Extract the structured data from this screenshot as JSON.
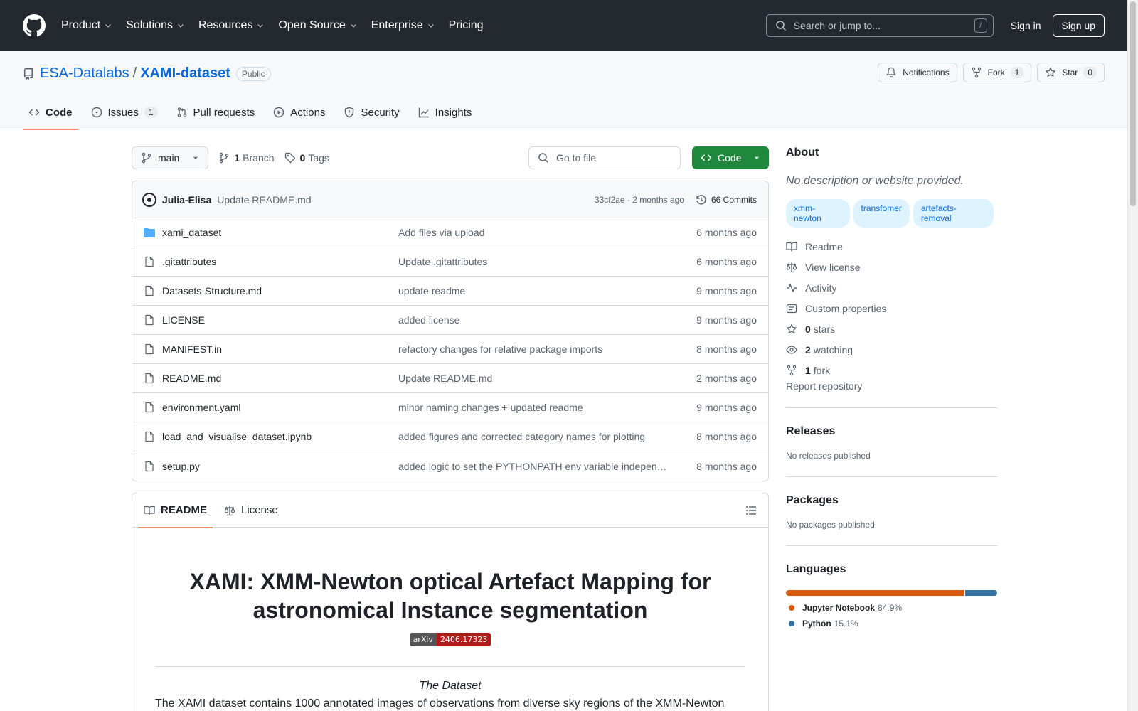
{
  "header": {
    "nav": [
      {
        "label": "Product",
        "dropdown": true
      },
      {
        "label": "Solutions",
        "dropdown": true
      },
      {
        "label": "Resources",
        "dropdown": true
      },
      {
        "label": "Open Source",
        "dropdown": true
      },
      {
        "label": "Enterprise",
        "dropdown": true
      },
      {
        "label": "Pricing",
        "dropdown": false
      }
    ],
    "search_placeholder": "Search or jump to...",
    "search_shortcut": "/",
    "sign_in": "Sign in",
    "sign_up": "Sign up"
  },
  "repo": {
    "owner": "ESA-Datalabs",
    "separator": "/",
    "name": "XAMI-dataset",
    "visibility": "Public",
    "actions": {
      "notifications": "Notifications",
      "fork_label": "Fork",
      "fork_count": "1",
      "star_label": "Star",
      "star_count": "0"
    },
    "tabs": [
      {
        "label": "Code",
        "icon": "code-icon",
        "active": true
      },
      {
        "label": "Issues",
        "icon": "issue-opened-icon",
        "counter": "1"
      },
      {
        "label": "Pull requests",
        "icon": "git-pull-request-icon"
      },
      {
        "label": "Actions",
        "icon": "play-icon"
      },
      {
        "label": "Security",
        "icon": "shield-icon"
      },
      {
        "label": "Insights",
        "icon": "graph-icon"
      }
    ]
  },
  "toolbar": {
    "branch": "main",
    "branch_count": "1",
    "branch_label": "Branch",
    "tag_count": "0",
    "tag_label": "Tags",
    "goto_placeholder": "Go to file",
    "code_button": "Code"
  },
  "latest_commit": {
    "author": "Julia-Elisa",
    "message": "Update README.md",
    "meta": "33cf2ae · 2 months ago",
    "commits": "66 Commits"
  },
  "files": [
    {
      "type": "dir",
      "name": "xami_dataset",
      "commit": "Add files via upload",
      "age": "6 months ago"
    },
    {
      "type": "file",
      "name": ".gitattributes",
      "commit": "Update .gitattributes",
      "age": "6 months ago"
    },
    {
      "type": "file",
      "name": "Datasets-Structure.md",
      "commit": "update readme",
      "age": "9 months ago"
    },
    {
      "type": "file",
      "name": "LICENSE",
      "commit": "added license",
      "age": "9 months ago"
    },
    {
      "type": "file",
      "name": "MANIFEST.in",
      "commit": "refactory changes for relative package imports",
      "age": "8 months ago"
    },
    {
      "type": "file",
      "name": "README.md",
      "commit": "Update README.md",
      "age": "2 months ago"
    },
    {
      "type": "file",
      "name": "environment.yaml",
      "commit": "minor naming changes + updated readme",
      "age": "9 months ago"
    },
    {
      "type": "file",
      "name": "load_and_visualise_dataset.ipynb",
      "commit": "added figures and corrected category names for plotting",
      "age": "8 months ago"
    },
    {
      "type": "file",
      "name": "setup.py",
      "commit": "added logic to set the PYTHONPATH env variable indepen…",
      "age": "8 months ago"
    }
  ],
  "readme": {
    "tab_readme": "README",
    "tab_license": "License",
    "title": "XAMI: XMM-Newton optical Artefact Mapping for astronomical Instance segmentation",
    "badge_left": "arXiv",
    "badge_right": "2406.17323",
    "section_em": "The Dataset",
    "paragraph": "The XAMI dataset contains 1000 annotated images of observations from diverse sky regions of the XMM-Newton"
  },
  "sidebar": {
    "about_title": "About",
    "about_desc": "No description or website provided.",
    "topics": [
      "xmm-newton",
      "transfomer",
      "artefacts-removal"
    ],
    "links": [
      {
        "icon": "book-icon",
        "label": "Readme"
      },
      {
        "icon": "law-icon",
        "label": "View license"
      },
      {
        "icon": "pulse-icon",
        "label": "Activity"
      },
      {
        "icon": "note-icon",
        "label": "Custom properties"
      },
      {
        "icon": "star-icon",
        "bold": "0",
        "label": "stars"
      },
      {
        "icon": "eye-icon",
        "bold": "2",
        "label": "watching"
      },
      {
        "icon": "repo-forked-icon",
        "bold": "1",
        "label": "fork"
      }
    ],
    "report": "Report repository",
    "releases_title": "Releases",
    "releases_text": "No releases published",
    "packages_title": "Packages",
    "packages_text": "No packages published",
    "languages_title": "Languages",
    "languages": [
      {
        "name": "Jupyter Notebook",
        "pct": "84.9%",
        "value": 84.9,
        "color": "#DA5B0B"
      },
      {
        "name": "Python",
        "pct": "15.1%",
        "value": 15.1,
        "color": "#3572A5"
      }
    ]
  }
}
